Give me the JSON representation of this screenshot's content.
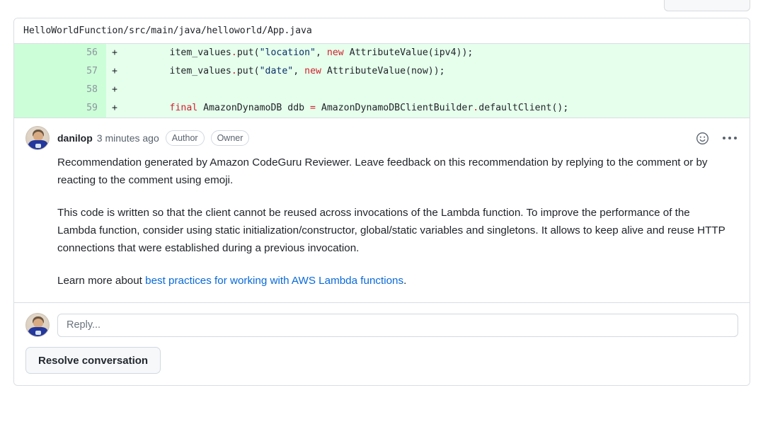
{
  "file": {
    "path": "HelloWorldFunction/src/main/java/helloworld/App.java"
  },
  "diff": {
    "lines": [
      {
        "number": "56",
        "marker": "+",
        "indent": "        ",
        "tokens": [
          {
            "t": "item_values",
            "c": "plain"
          },
          {
            "t": ".",
            "c": "dot"
          },
          {
            "t": "put(",
            "c": "plain"
          },
          {
            "t": "\"location\"",
            "c": "str"
          },
          {
            "t": ", ",
            "c": "plain"
          },
          {
            "t": "new",
            "c": "kw"
          },
          {
            "t": " AttributeValue(ipv4));",
            "c": "plain"
          }
        ]
      },
      {
        "number": "57",
        "marker": "+",
        "indent": "        ",
        "tokens": [
          {
            "t": "item_values",
            "c": "plain"
          },
          {
            "t": ".",
            "c": "dot"
          },
          {
            "t": "put(",
            "c": "plain"
          },
          {
            "t": "\"date\"",
            "c": "str"
          },
          {
            "t": ", ",
            "c": "plain"
          },
          {
            "t": "new",
            "c": "kw"
          },
          {
            "t": " AttributeValue(now));",
            "c": "plain"
          }
        ]
      },
      {
        "number": "58",
        "marker": "+",
        "indent": "",
        "tokens": []
      },
      {
        "number": "59",
        "marker": "+",
        "indent": "        ",
        "tokens": [
          {
            "t": "final",
            "c": "kw"
          },
          {
            "t": " AmazonDynamoDB ddb ",
            "c": "plain"
          },
          {
            "t": "=",
            "c": "op"
          },
          {
            "t": " AmazonDynamoDBClientBuilder",
            "c": "plain"
          },
          {
            "t": ".",
            "c": "dot"
          },
          {
            "t": "defaultClient();",
            "c": "plain"
          }
        ]
      }
    ]
  },
  "comment": {
    "author": "danilop",
    "timestamp": "3 minutes ago",
    "badges": [
      "Author",
      "Owner"
    ],
    "reaction_icon": "smiley-face-icon",
    "menu_icon": "kebab-menu-icon",
    "paragraphs": [
      "Recommendation generated by Amazon CodeGuru Reviewer. Leave feedback on this recommendation by replying to the comment or by reacting to the comment using emoji.",
      "This code is written so that the client cannot be reused across invocations of the Lambda function.\nTo improve the performance of the Lambda function, consider using static initialization/constructor, global/static variables and singletons. It allows to keep alive and reuse HTTP connections that were established during a previous invocation."
    ],
    "learn_more_prefix": "Learn more about ",
    "learn_more_link": "best practices for working with AWS Lambda functions",
    "learn_more_suffix": "."
  },
  "reply": {
    "placeholder": "Reply..."
  },
  "actions": {
    "resolve_label": "Resolve conversation"
  },
  "colors": {
    "diff_add_bg": "#e6ffec",
    "diff_gutter_bg": "#ccffd8",
    "link": "#0969da",
    "border": "#d8dee4",
    "muted_text": "#59636e"
  }
}
